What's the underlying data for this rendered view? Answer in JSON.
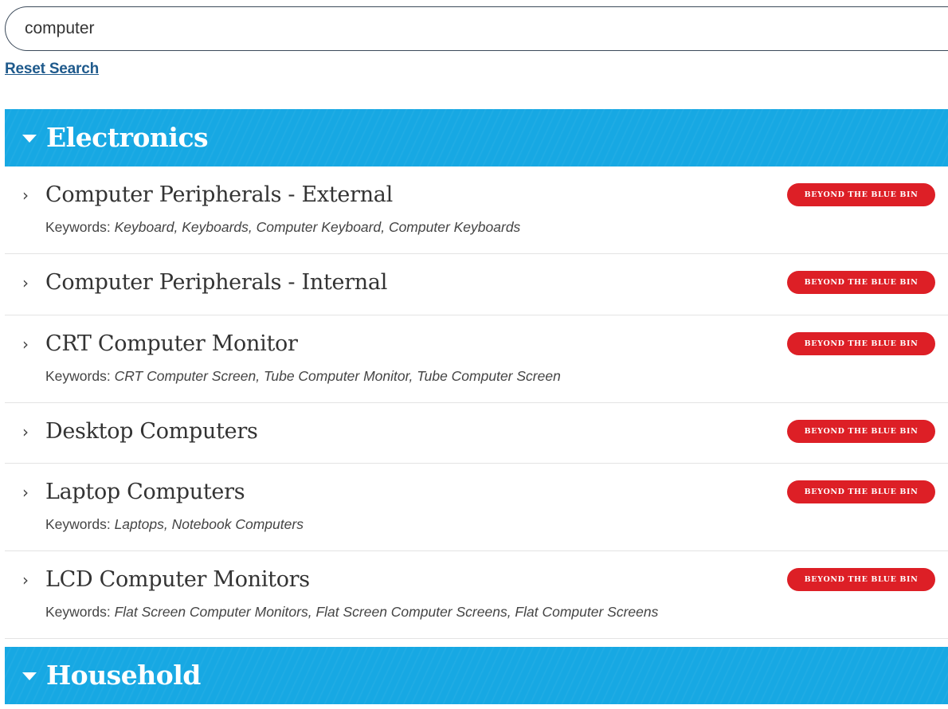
{
  "search": {
    "value": "computer",
    "reset_label": "Reset Search"
  },
  "categories": [
    {
      "title": "Electronics",
      "icon": "caret-down-icon",
      "items": [
        {
          "name": "Computer Peripherals - External",
          "keywords_label": "Keywords:",
          "keywords": "Keyboard, Keyboards, Computer Keyboard, Computer Keyboards",
          "badge": "BEYOND THE BLUE BIN"
        },
        {
          "name": "Computer Peripherals - Internal",
          "badge": "BEYOND THE BLUE BIN"
        },
        {
          "name": "CRT Computer Monitor",
          "keywords_label": "Keywords:",
          "keywords": "CRT Computer Screen, Tube Computer Monitor, Tube Computer Screen",
          "badge": "BEYOND THE BLUE BIN"
        },
        {
          "name": "Desktop Computers",
          "badge": "BEYOND THE BLUE BIN"
        },
        {
          "name": "Laptop Computers",
          "keywords_label": "Keywords:",
          "keywords": "Laptops, Notebook Computers",
          "badge": "BEYOND THE BLUE BIN"
        },
        {
          "name": "LCD Computer Monitors",
          "keywords_label": "Keywords:",
          "keywords": "Flat Screen Computer Monitors, Flat Screen Computer Screens, Flat Computer Screens",
          "badge": "BEYOND THE BLUE BIN"
        }
      ]
    },
    {
      "title": "Household",
      "icon": "caret-down-icon"
    }
  ],
  "colors": {
    "header_blue": "#17a8e3",
    "badge_red": "#dd1f26",
    "link_blue": "#1f5a8c"
  }
}
